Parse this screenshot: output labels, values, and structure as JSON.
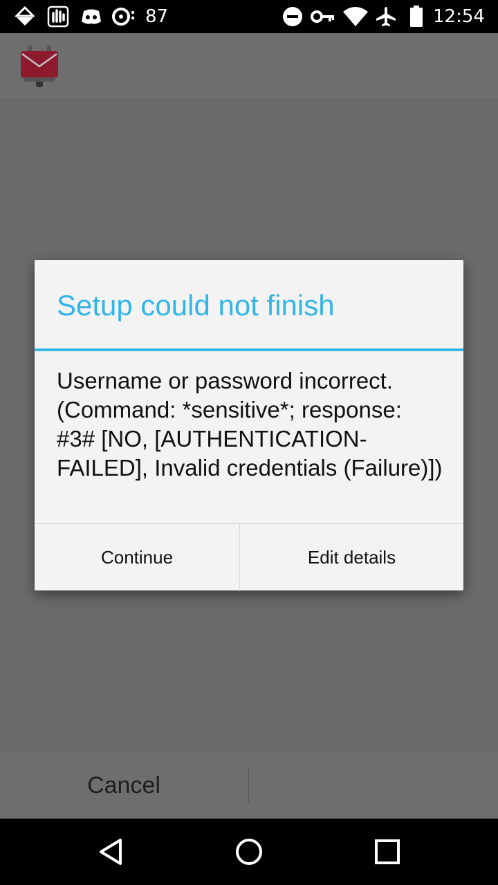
{
  "status_bar": {
    "notification_count": "87",
    "time": "12:54",
    "icons": [
      "download-icon",
      "hand-icon",
      "discord-icon",
      "media-icon",
      "dnd-icon",
      "vpn-key-icon",
      "wifi-icon",
      "airplane-icon",
      "battery-icon"
    ]
  },
  "app_bar": {
    "logo_icon": "k9-mail-logo-icon"
  },
  "dialog": {
    "title": "Setup could not finish",
    "message": "Username or password incorrect. (Command: *sensitive*; response: #3# [NO, [AUTHENTICATION-FAILED], Invalid credentials (Failure)])",
    "buttons": {
      "continue_label": "Continue",
      "edit_label": "Edit details"
    },
    "accent_color": "#33b5e5"
  },
  "bottom_bar": {
    "cancel_label": "Cancel"
  },
  "nav_bar": {
    "icons": [
      "back-icon",
      "home-icon",
      "recents-icon"
    ]
  }
}
